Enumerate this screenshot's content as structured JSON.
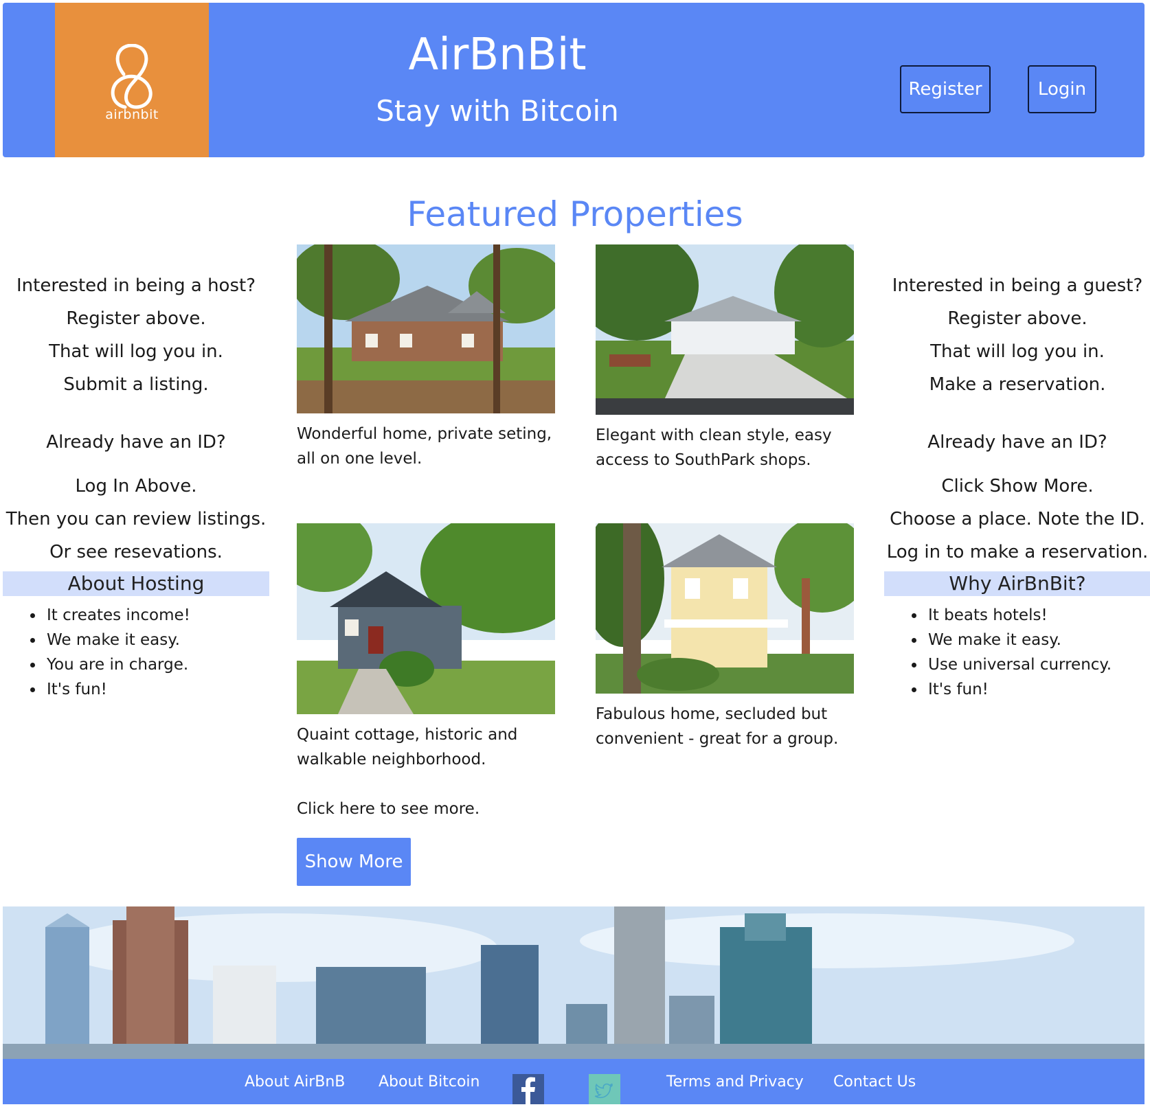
{
  "header": {
    "logo_text": "airbnbit",
    "title": "AirBnBit",
    "tagline": "Stay with Bitcoin",
    "register_label": "Register",
    "login_label": "Login",
    "bg_color": "#5a87f5",
    "logo_bg_color": "#e8903d"
  },
  "featured": {
    "title": "Featured Properties",
    "properties": [
      {
        "caption_l1": "Wonderful home, private seting,",
        "caption_l2": "all on one level."
      },
      {
        "caption_l1": "Elegant with clean style, easy",
        "caption_l2": "access to SouthPark shops."
      },
      {
        "caption_l1": "Quaint cottage, historic and",
        "caption_l2": "walkable neighborhood."
      },
      {
        "caption_l1": "Fabulous home, secluded but",
        "caption_l2": "convenient - great for a group."
      }
    ],
    "see_more_text": "Click here to see more.",
    "show_more_label": "Show More"
  },
  "host_column": {
    "lines_a": [
      "Interested in being a host?",
      "Register above.",
      "That will log you in.",
      "Submit a listing."
    ],
    "already": "Already have an ID?",
    "lines_b": [
      "Log In Above.",
      "Then you can review listings.",
      "Or see resevations."
    ],
    "heading": "About Hosting",
    "bullets": [
      "It creates income!",
      "We make it easy.",
      "You are in charge.",
      "It's fun!"
    ]
  },
  "guest_column": {
    "lines_a": [
      "Interested in being a guest?",
      "Register above.",
      "That will log you in.",
      "Make a reservation."
    ],
    "already": "Already have an ID?",
    "lines_b": [
      "Click Show More.",
      "Choose a place. Note the ID.",
      "Log in to make a reservation."
    ],
    "heading": "Why AirBnBit?",
    "bullets": [
      "It beats hotels!",
      "We make it easy.",
      "Use universal currency.",
      "It's fun!"
    ]
  },
  "footer": {
    "about_airbnb": "About AirBnB",
    "about_bitcoin": "About Bitcoin",
    "facebook_icon": "facebook-icon",
    "twitter_icon": "twitter-icon",
    "terms": "Terms and Privacy",
    "contact": "Contact Us"
  }
}
